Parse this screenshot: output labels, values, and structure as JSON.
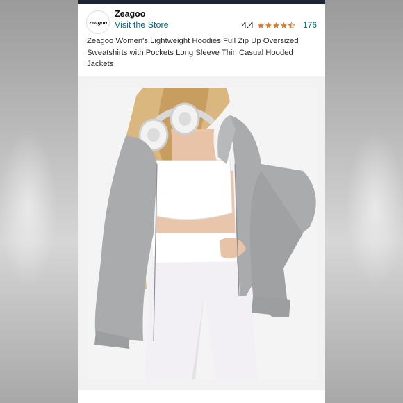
{
  "store": {
    "logo_text": "zeagoo",
    "name": "Zeagoo",
    "visit_label": "Visit the Store"
  },
  "rating": {
    "value": "4.4",
    "stars": 4.4,
    "star_color": "#de7921",
    "count": "176"
  },
  "product": {
    "title": "Zeagoo Women's Lightweight Hoodies Full Zip Up Oversized Sweatshirts with Pockets Long Sleeve Thin Casual Hooded Jackets"
  },
  "colors": {
    "link": "#007185",
    "top_bar": "#1f2633",
    "hoodie": "#a9abad",
    "top": "#ffffff"
  },
  "icons": [
    "star-icon",
    "half-star-icon",
    "headphones-icon"
  ]
}
